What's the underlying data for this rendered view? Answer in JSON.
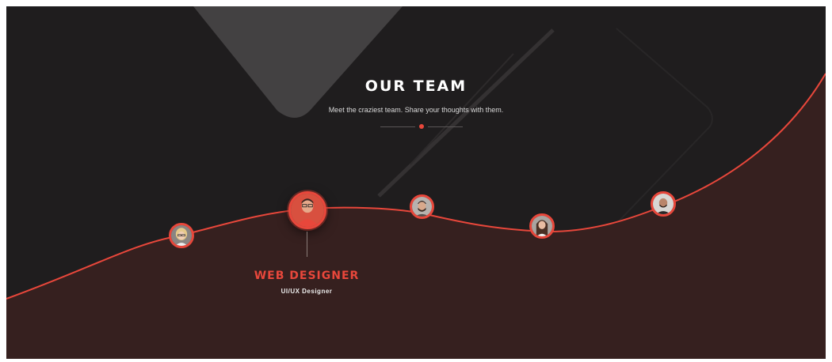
{
  "section": {
    "title": "OUR TEAM",
    "subtitle": "Meet the craziest team. Share your thoughts with them."
  },
  "colors": {
    "accent": "#e8473b",
    "dark_bg": "#1f1d1e",
    "lower_bg": "#36201f"
  },
  "active_member": {
    "role": "WEB DESIGNER",
    "subrole": "UI/UX Designer"
  },
  "members": [
    {
      "icon": "avatar-woman-blonde-glasses"
    },
    {
      "icon": "avatar-man-red-shirt",
      "active": true
    },
    {
      "icon": "avatar-man-beard"
    },
    {
      "icon": "avatar-woman-long-hair"
    },
    {
      "icon": "avatar-man-bald"
    }
  ]
}
